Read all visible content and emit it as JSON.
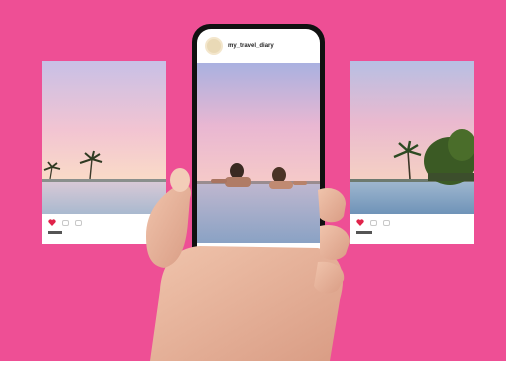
{
  "phone": {
    "username": "my_travel_diary"
  },
  "colors": {
    "background": "#ee4f95",
    "like": "#e0234a",
    "phone_body": "#111111",
    "skin": "#e9b8a0"
  },
  "icons": [
    "heart-icon",
    "comment-icon",
    "share-icon",
    "home-icon",
    "search-icon",
    "reels-icon",
    "shop-icon",
    "profile-icon"
  ]
}
